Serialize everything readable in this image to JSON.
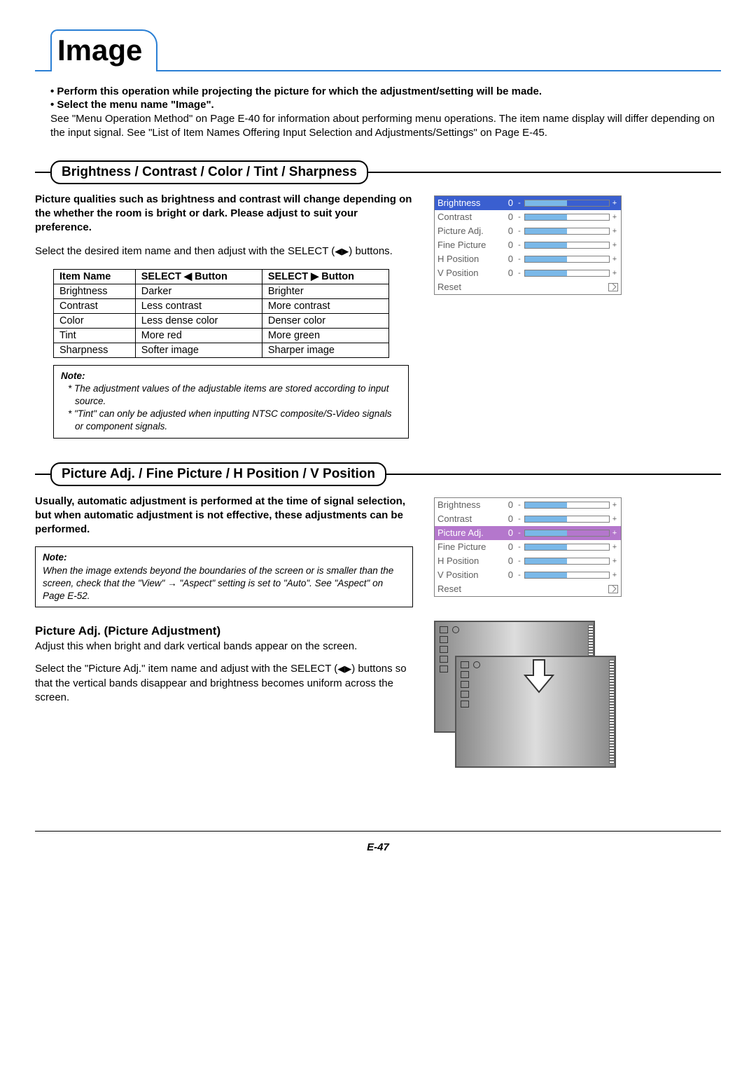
{
  "page": {
    "title": "Image",
    "footer": "E-47"
  },
  "intro": {
    "bullet1": "Perform this operation while projecting the picture for which the adjustment/setting will be made.",
    "bullet2": "Select the menu name \"Image\".",
    "plain": "See \"Menu Operation Method\" on Page E-40 for information about performing menu operations. The item name display will differ depending on the input signal. See \"List of Item Names Offering Input Selection and Adjustments/Settings\" on Page E-45."
  },
  "section1": {
    "heading": "Brightness / Contrast / Color / Tint / Sharpness",
    "lead": "Picture qualities such as brightness and contrast will change depending on the whether the room is bright or dark. Please adjust to suit your preference.",
    "instr_a": "Select the desired item name and then adjust with the SELECT (",
    "instr_b": ") buttons.",
    "table": {
      "h1": "Item Name",
      "h2": "SELECT ◀ Button",
      "h3": "SELECT ▶ Button",
      "rows": [
        [
          "Brightness",
          "Darker",
          "Brighter"
        ],
        [
          "Contrast",
          "Less contrast",
          "More contrast"
        ],
        [
          "Color",
          "Less dense color",
          "Denser color"
        ],
        [
          "Tint",
          "More red",
          "More green"
        ],
        [
          "Sharpness",
          "Softer image",
          "Sharper image"
        ]
      ]
    },
    "note": {
      "title": "Note:",
      "l1": "* The adjustment values of the adjustable items are stored according to input source.",
      "l2": "* \"Tint\" can only be adjusted when inputting NTSC composite/S-Video signals or component signals."
    }
  },
  "osd1": {
    "rows": [
      {
        "label": "Brightness",
        "val": "0",
        "sel": true
      },
      {
        "label": "Contrast",
        "val": "0"
      },
      {
        "label": "Picture Adj.",
        "val": "0"
      },
      {
        "label": "Fine Picture",
        "val": "0"
      },
      {
        "label": "H Position",
        "val": "0"
      },
      {
        "label": "V Position",
        "val": "0"
      }
    ],
    "reset": "Reset"
  },
  "section2": {
    "heading": "Picture Adj. / Fine Picture / H Position / V Position",
    "lead": "Usually, automatic adjustment is performed at the time of signal selection, but when automatic adjustment is not effective, these adjustments can be performed.",
    "note": {
      "title": "Note:",
      "l1": "When the image extends beyond the boundaries of the screen or is smaller than the screen, check that the \"View\" → \"Aspect\" setting is set to \"Auto\". See \"Aspect\" on Page E-52."
    },
    "sub": {
      "title": "Picture Adj. (Picture Adjustment)",
      "p1": "Adjust this when bright and dark vertical bands appear on the screen.",
      "p2a": "Select the \"Picture Adj.\" item name and adjust with the SELECT (",
      "p2b": ") buttons so that the vertical bands disappear and brightness becomes uniform across the screen."
    }
  },
  "osd2": {
    "rows": [
      {
        "label": "Brightness",
        "val": "0"
      },
      {
        "label": "Contrast",
        "val": "0"
      },
      {
        "label": "Picture Adj.",
        "val": "0",
        "sel2": true
      },
      {
        "label": "Fine Picture",
        "val": "0"
      },
      {
        "label": "H Position",
        "val": "0"
      },
      {
        "label": "V Position",
        "val": "0"
      }
    ],
    "reset": "Reset"
  }
}
